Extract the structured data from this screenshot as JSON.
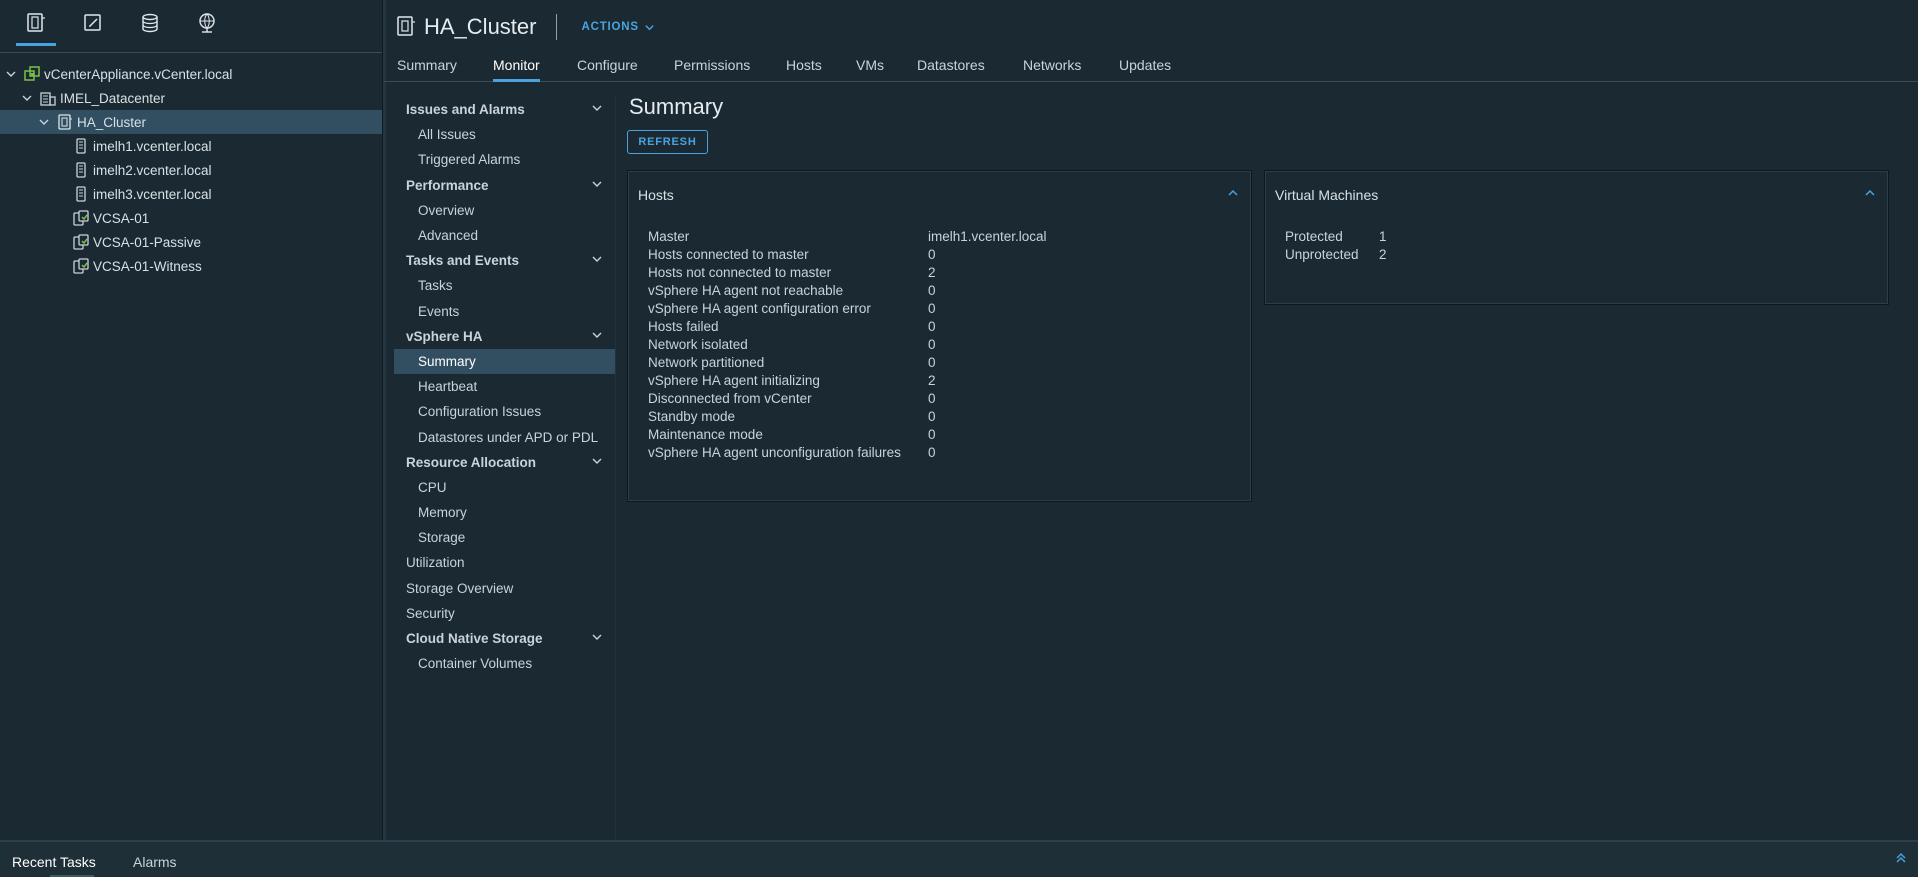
{
  "inventory_tabs": [
    {
      "icon": "hosts-clusters-icon",
      "active": true
    },
    {
      "icon": "vms-templates-icon",
      "active": false
    },
    {
      "icon": "storage-icon",
      "active": false
    },
    {
      "icon": "networking-icon",
      "active": false
    }
  ],
  "tree": [
    {
      "label": "vCenterAppliance.vCenter.local",
      "icon": "vcenter-icon",
      "level": 0,
      "expanded": true
    },
    {
      "label": "IMEL_Datacenter",
      "icon": "datacenter-icon",
      "level": 1,
      "expanded": true
    },
    {
      "label": "HA_Cluster",
      "icon": "cluster-icon",
      "level": 2,
      "expanded": true,
      "selected": true
    },
    {
      "label": "imelh1.vcenter.local",
      "icon": "host-icon",
      "level": 3
    },
    {
      "label": "imelh2.vcenter.local",
      "icon": "host-icon",
      "level": 3
    },
    {
      "label": "imelh3.vcenter.local",
      "icon": "host-icon",
      "level": 3
    },
    {
      "label": "VCSA-01",
      "icon": "vm-icon",
      "level": 3
    },
    {
      "label": "VCSA-01-Passive",
      "icon": "vm-icon",
      "level": 3
    },
    {
      "label": "VCSA-01-Witness",
      "icon": "vm-icon",
      "level": 3
    }
  ],
  "header": {
    "title": "HA_Cluster",
    "actions_label": "ACTIONS"
  },
  "main_tabs": [
    "Summary",
    "Monitor",
    "Configure",
    "Permissions",
    "Hosts",
    "VMs",
    "Datastores",
    "Networks",
    "Updates"
  ],
  "main_tabs_active": "Monitor",
  "monitor_nav": [
    {
      "type": "section",
      "label": "Issues and Alarms"
    },
    {
      "type": "item",
      "label": "All Issues"
    },
    {
      "type": "item",
      "label": "Triggered Alarms"
    },
    {
      "type": "section",
      "label": "Performance"
    },
    {
      "type": "item",
      "label": "Overview"
    },
    {
      "type": "item",
      "label": "Advanced"
    },
    {
      "type": "section",
      "label": "Tasks and Events"
    },
    {
      "type": "item",
      "label": "Tasks"
    },
    {
      "type": "item",
      "label": "Events"
    },
    {
      "type": "section",
      "label": "vSphere HA"
    },
    {
      "type": "item",
      "label": "Summary",
      "selected": true
    },
    {
      "type": "item",
      "label": "Heartbeat"
    },
    {
      "type": "item",
      "label": "Configuration Issues"
    },
    {
      "type": "item",
      "label": "Datastores under APD or PDL"
    },
    {
      "type": "section",
      "label": "Resource Allocation"
    },
    {
      "type": "item",
      "label": "CPU"
    },
    {
      "type": "item",
      "label": "Memory"
    },
    {
      "type": "item",
      "label": "Storage"
    },
    {
      "type": "top",
      "label": "Utilization"
    },
    {
      "type": "top",
      "label": "Storage Overview"
    },
    {
      "type": "top",
      "label": "Security"
    },
    {
      "type": "section",
      "label": "Cloud Native Storage"
    },
    {
      "type": "item",
      "label": "Container Volumes"
    }
  ],
  "content": {
    "title": "Summary",
    "refresh_label": "REFRESH"
  },
  "hosts_card": {
    "title": "Hosts",
    "rows": [
      {
        "label": "Master",
        "value": "imelh1.vcenter.local"
      },
      {
        "label": "Hosts connected to master",
        "value": "0"
      },
      {
        "label": "Hosts not connected to master",
        "value": "2"
      },
      {
        "label": "vSphere HA agent not reachable",
        "value": "0"
      },
      {
        "label": "vSphere HA agent configuration error",
        "value": "0"
      },
      {
        "label": "Hosts failed",
        "value": "0"
      },
      {
        "label": "Network isolated",
        "value": "0"
      },
      {
        "label": "Network partitioned",
        "value": "0"
      },
      {
        "label": "vSphere HA agent initializing",
        "value": "2"
      },
      {
        "label": "Disconnected from vCenter",
        "value": "0"
      },
      {
        "label": "Standby mode",
        "value": "0"
      },
      {
        "label": "Maintenance mode",
        "value": "0"
      },
      {
        "label": "vSphere HA agent unconfiguration failures",
        "value": "0"
      }
    ]
  },
  "vms_card": {
    "title": "Virtual Machines",
    "rows": [
      {
        "label": "Protected",
        "value": "1"
      },
      {
        "label": "Unprotected",
        "value": "2"
      }
    ]
  },
  "bottom_tabs": [
    "Recent Tasks",
    "Alarms"
  ],
  "bottom_tabs_active": "Recent Tasks",
  "colors": {
    "background": "#1b2a32",
    "accent": "#4aa3df",
    "selected_row": "#324f61",
    "vcenter_icon": "#7cc04b"
  }
}
